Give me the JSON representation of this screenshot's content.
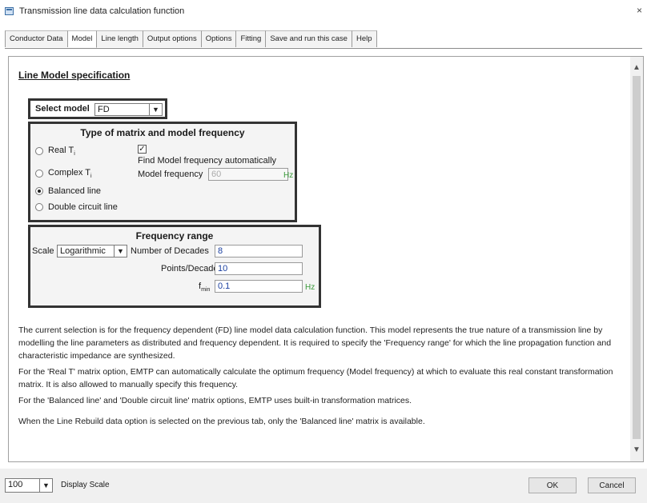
{
  "window": {
    "title": "Transmission line data calculation function",
    "close": "×"
  },
  "tabs": [
    {
      "label": "Conductor Data"
    },
    {
      "label": "Model"
    },
    {
      "label": "Line length"
    },
    {
      "label": "Output options"
    },
    {
      "label": "Options"
    },
    {
      "label": "Fitting"
    },
    {
      "label": "Save and run this case"
    },
    {
      "label": "Help"
    }
  ],
  "section_title": "Line Model specification",
  "select_model": {
    "label": "Select model",
    "value": "FD"
  },
  "matrix_box": {
    "title": "Type of matrix and model frequency",
    "radios": [
      {
        "label": "Real T",
        "sub": "i",
        "selected": false
      },
      {
        "label": "Complex T",
        "sub": "i",
        "selected": false
      },
      {
        "label": "Balanced line",
        "selected": true
      },
      {
        "label": "Double circuit line",
        "selected": false
      }
    ],
    "auto_freq_checked": true,
    "auto_freq_label": "Find Model frequency automatically",
    "model_freq_label": "Model frequency",
    "model_freq_value": "60",
    "model_freq_unit": "Hz"
  },
  "freq_box": {
    "title": "Frequency range",
    "scale_label": "Scale",
    "scale_value": "Logarithmic",
    "decades_label": "Number of Decades",
    "decades_value": "8",
    "points_label": "Points/Decade",
    "points_value": "10",
    "fmin_label": "f",
    "fmin_sub": "min",
    "fmin_value": "0.1",
    "fmin_unit": "Hz"
  },
  "paragraphs": [
    "The current selection is for the frequency dependent (FD) line model data calculation function. This model represents the true nature of a transmission line by modelling the line parameters as distributed and frequency dependent. It is required to specify the 'Frequency range' for which the line propagation function and characteristic impedance are synthesized.",
    "For the 'Real T' matrix option, EMTP can automatically calculate the optimum frequency (Model frequency) at which to evaluate this real constant transformation matrix. It is also allowed to manually specify this frequency.",
    "For the 'Balanced line' and 'Double circuit line' matrix options, EMTP uses built-in transformation matrices.",
    "When the Line Rebuild data option is selected on the previous tab, only the 'Balanced line' matrix is available."
  ],
  "bottom": {
    "zoom_value": "100",
    "display_scale_label": "Display Scale",
    "ok_label": "OK",
    "cancel_label": "Cancel"
  }
}
